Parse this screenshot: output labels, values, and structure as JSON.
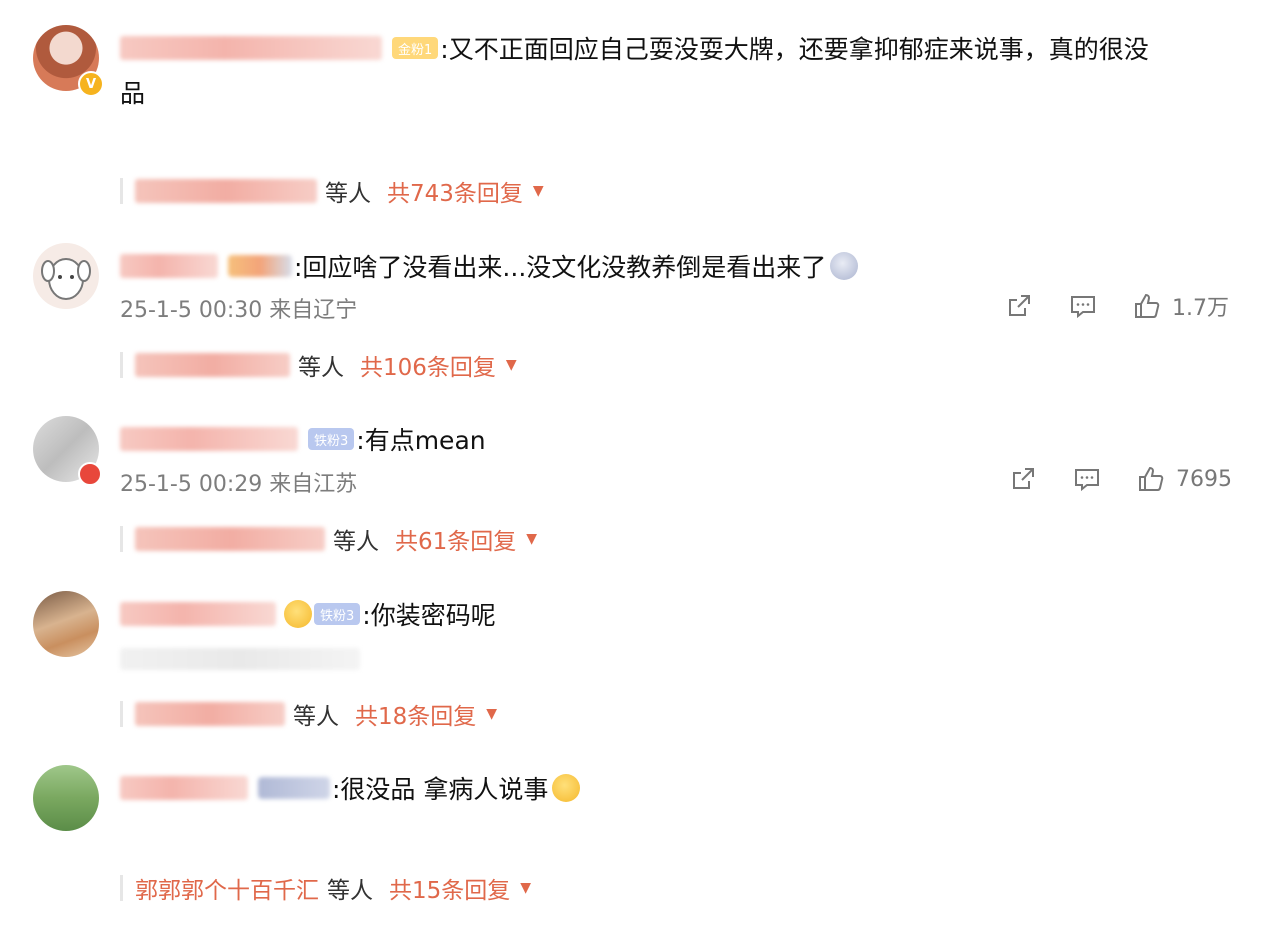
{
  "comments": [
    {
      "badge": "金粉1",
      "text": ":又不正面回应自己耍没耍大牌，还要拿抑郁症来说事，真的很没",
      "text_cont": "品",
      "replies": {
        "etc": "等人",
        "count": "共743条回复"
      }
    },
    {
      "text": ":回应啥了没看出来...没文化没教养倒是看出来了",
      "time": "25-1-5 00:30 来自辽宁",
      "likes": "1.7万",
      "replies": {
        "etc": "等人",
        "count": "共106条回复"
      }
    },
    {
      "badge": "铁粉3",
      "text": ":有点mean",
      "time": "25-1-5 00:29 来自江苏",
      "likes": "7695",
      "replies": {
        "etc": "等人",
        "count": "共61条回复"
      }
    },
    {
      "badge": "铁粉3",
      "text": ":你装密码呢",
      "replies": {
        "etc": "等人",
        "count": "共18条回复"
      }
    },
    {
      "text": ":很没品 拿病人说事",
      "replies": {
        "name": "郭郭郭个十百千汇",
        "etc": "等人",
        "count": "共15条回复"
      }
    }
  ],
  "icons": {
    "share": "share-icon",
    "comment": "comment-icon",
    "like": "thumbs-up-icon",
    "expand": "caret-down-icon"
  },
  "colors": {
    "accent": "#e0684a",
    "meta": "#7d7d7d"
  }
}
